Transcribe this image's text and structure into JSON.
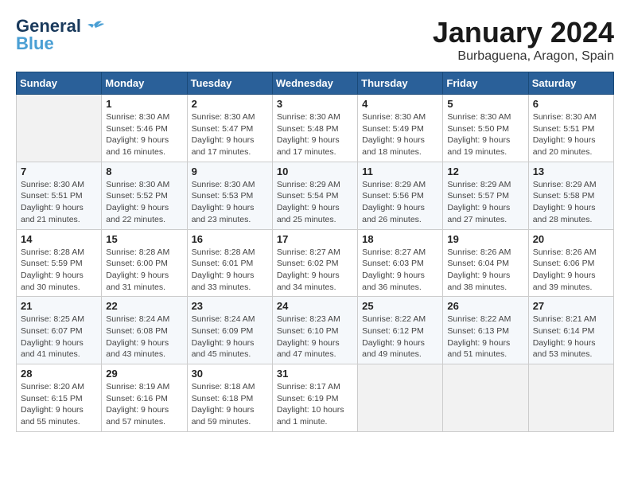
{
  "header": {
    "logo_general": "General",
    "logo_blue": "Blue",
    "month_title": "January 2024",
    "location": "Burbaguena, Aragon, Spain"
  },
  "weekdays": [
    "Sunday",
    "Monday",
    "Tuesday",
    "Wednesday",
    "Thursday",
    "Friday",
    "Saturday"
  ],
  "weeks": [
    [
      {
        "day": "",
        "info": ""
      },
      {
        "day": "1",
        "info": "Sunrise: 8:30 AM\nSunset: 5:46 PM\nDaylight: 9 hours\nand 16 minutes."
      },
      {
        "day": "2",
        "info": "Sunrise: 8:30 AM\nSunset: 5:47 PM\nDaylight: 9 hours\nand 17 minutes."
      },
      {
        "day": "3",
        "info": "Sunrise: 8:30 AM\nSunset: 5:48 PM\nDaylight: 9 hours\nand 17 minutes."
      },
      {
        "day": "4",
        "info": "Sunrise: 8:30 AM\nSunset: 5:49 PM\nDaylight: 9 hours\nand 18 minutes."
      },
      {
        "day": "5",
        "info": "Sunrise: 8:30 AM\nSunset: 5:50 PM\nDaylight: 9 hours\nand 19 minutes."
      },
      {
        "day": "6",
        "info": "Sunrise: 8:30 AM\nSunset: 5:51 PM\nDaylight: 9 hours\nand 20 minutes."
      }
    ],
    [
      {
        "day": "7",
        "info": "Sunrise: 8:30 AM\nSunset: 5:51 PM\nDaylight: 9 hours\nand 21 minutes."
      },
      {
        "day": "8",
        "info": "Sunrise: 8:30 AM\nSunset: 5:52 PM\nDaylight: 9 hours\nand 22 minutes."
      },
      {
        "day": "9",
        "info": "Sunrise: 8:30 AM\nSunset: 5:53 PM\nDaylight: 9 hours\nand 23 minutes."
      },
      {
        "day": "10",
        "info": "Sunrise: 8:29 AM\nSunset: 5:54 PM\nDaylight: 9 hours\nand 25 minutes."
      },
      {
        "day": "11",
        "info": "Sunrise: 8:29 AM\nSunset: 5:56 PM\nDaylight: 9 hours\nand 26 minutes."
      },
      {
        "day": "12",
        "info": "Sunrise: 8:29 AM\nSunset: 5:57 PM\nDaylight: 9 hours\nand 27 minutes."
      },
      {
        "day": "13",
        "info": "Sunrise: 8:29 AM\nSunset: 5:58 PM\nDaylight: 9 hours\nand 28 minutes."
      }
    ],
    [
      {
        "day": "14",
        "info": "Sunrise: 8:28 AM\nSunset: 5:59 PM\nDaylight: 9 hours\nand 30 minutes."
      },
      {
        "day": "15",
        "info": "Sunrise: 8:28 AM\nSunset: 6:00 PM\nDaylight: 9 hours\nand 31 minutes."
      },
      {
        "day": "16",
        "info": "Sunrise: 8:28 AM\nSunset: 6:01 PM\nDaylight: 9 hours\nand 33 minutes."
      },
      {
        "day": "17",
        "info": "Sunrise: 8:27 AM\nSunset: 6:02 PM\nDaylight: 9 hours\nand 34 minutes."
      },
      {
        "day": "18",
        "info": "Sunrise: 8:27 AM\nSunset: 6:03 PM\nDaylight: 9 hours\nand 36 minutes."
      },
      {
        "day": "19",
        "info": "Sunrise: 8:26 AM\nSunset: 6:04 PM\nDaylight: 9 hours\nand 38 minutes."
      },
      {
        "day": "20",
        "info": "Sunrise: 8:26 AM\nSunset: 6:06 PM\nDaylight: 9 hours\nand 39 minutes."
      }
    ],
    [
      {
        "day": "21",
        "info": "Sunrise: 8:25 AM\nSunset: 6:07 PM\nDaylight: 9 hours\nand 41 minutes."
      },
      {
        "day": "22",
        "info": "Sunrise: 8:24 AM\nSunset: 6:08 PM\nDaylight: 9 hours\nand 43 minutes."
      },
      {
        "day": "23",
        "info": "Sunrise: 8:24 AM\nSunset: 6:09 PM\nDaylight: 9 hours\nand 45 minutes."
      },
      {
        "day": "24",
        "info": "Sunrise: 8:23 AM\nSunset: 6:10 PM\nDaylight: 9 hours\nand 47 minutes."
      },
      {
        "day": "25",
        "info": "Sunrise: 8:22 AM\nSunset: 6:12 PM\nDaylight: 9 hours\nand 49 minutes."
      },
      {
        "day": "26",
        "info": "Sunrise: 8:22 AM\nSunset: 6:13 PM\nDaylight: 9 hours\nand 51 minutes."
      },
      {
        "day": "27",
        "info": "Sunrise: 8:21 AM\nSunset: 6:14 PM\nDaylight: 9 hours\nand 53 minutes."
      }
    ],
    [
      {
        "day": "28",
        "info": "Sunrise: 8:20 AM\nSunset: 6:15 PM\nDaylight: 9 hours\nand 55 minutes."
      },
      {
        "day": "29",
        "info": "Sunrise: 8:19 AM\nSunset: 6:16 PM\nDaylight: 9 hours\nand 57 minutes."
      },
      {
        "day": "30",
        "info": "Sunrise: 8:18 AM\nSunset: 6:18 PM\nDaylight: 9 hours\nand 59 minutes."
      },
      {
        "day": "31",
        "info": "Sunrise: 8:17 AM\nSunset: 6:19 PM\nDaylight: 10 hours\nand 1 minute."
      },
      {
        "day": "",
        "info": ""
      },
      {
        "day": "",
        "info": ""
      },
      {
        "day": "",
        "info": ""
      }
    ]
  ]
}
